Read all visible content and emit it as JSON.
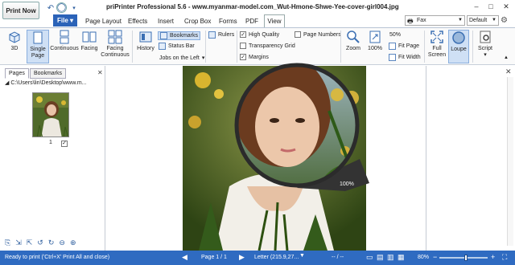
{
  "app": {
    "title": "priPrinter Professional 5.6 - www.myanmar-model.com_Wut-Hmone-Shwe-Yee-cover-girl004.jpg",
    "print_now": "Print Now"
  },
  "window_controls": {
    "minimize": "–",
    "maximize": "□",
    "close": "✕"
  },
  "menu": {
    "file": "File",
    "tabs": [
      "Page Layout",
      "Effects",
      "Insert",
      "Crop Box",
      "Forms",
      "PDF",
      "View"
    ],
    "printer": "Fax",
    "preset": "Default"
  },
  "ribbon": {
    "view_3d": "3D",
    "single_page": "Single Page",
    "continuous": "Continuous",
    "facing": "Facing",
    "facing_continuous": "Facing Continuous",
    "history": "History",
    "bookmarks": "Bookmarks",
    "status_bar": "Status Bar",
    "jobs_location": "Jobs on the Left",
    "rulers": "Rulers",
    "high_quality": "High Quality",
    "transparency": "Transparency Grid",
    "margins": "Margins",
    "page_numbers": "Page Numbers",
    "zoom": "Zoom",
    "zoom_100": "100%",
    "zoom_level": "50%",
    "fit_page": "Fit Page",
    "fit_width": "Fit Width",
    "full_screen": "Full Screen",
    "loupe": "Loupe",
    "script": "Script"
  },
  "left_panel": {
    "tabs": [
      "Pages",
      "Bookmarks"
    ],
    "path": "C:\\Users\\lin\\Desktop\\www.m...",
    "page_number": "1"
  },
  "main": {
    "loupe_zoom": "100%"
  },
  "status": {
    "message": "Ready to print ('Ctrl+X' Print All and close)",
    "page": "Page 1 / 1",
    "paper": "Letter (215.9,27...",
    "separator": "-- / --",
    "zoom": "80%",
    "zoom_fraction": 0.55
  },
  "colors": {
    "accent": "#2f6bc1",
    "file_tab": "#2b63b8",
    "selected": "#cfe0f5"
  }
}
